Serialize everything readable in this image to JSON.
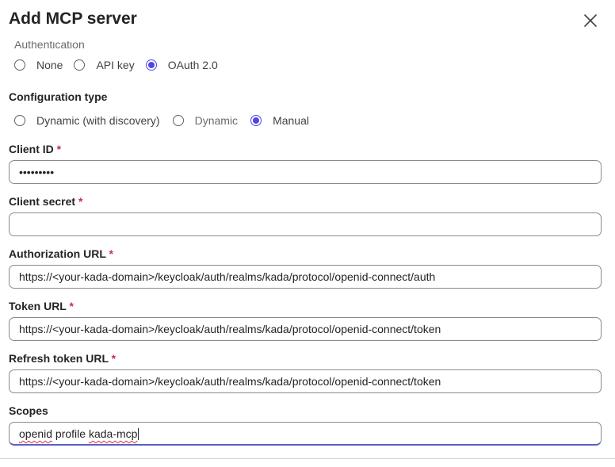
{
  "dialog": {
    "title": "Add MCP server"
  },
  "auth": {
    "section_label": "Authentication",
    "options": [
      {
        "label": "None",
        "checked": false
      },
      {
        "label": "API key",
        "checked": false
      },
      {
        "label": "OAuth 2.0",
        "checked": true
      }
    ]
  },
  "config_type": {
    "label": "Configuration type",
    "options": [
      {
        "label": "Dynamic (with discovery)",
        "checked": false
      },
      {
        "label": "Dynamic",
        "checked": false,
        "dim": true
      },
      {
        "label": "Manual",
        "checked": true
      }
    ]
  },
  "fields": {
    "client_id": {
      "label": "Client ID",
      "required_mark": "*",
      "value": "•••••••••"
    },
    "client_secret": {
      "label": "Client secret",
      "required_mark": "*",
      "value": ""
    },
    "authorization_url": {
      "label": "Authorization URL",
      "required_mark": "*",
      "value": "https://<your-kada-domain>/keycloak/auth/realms/kada/protocol/openid-connect/auth"
    },
    "token_url": {
      "label": "Token URL",
      "required_mark": "*",
      "value": "https://<your-kada-domain>/keycloak/auth/realms/kada/protocol/openid-connect/token"
    },
    "refresh_token_url": {
      "label": "Refresh token URL",
      "required_mark": "*",
      "value": "https://<your-kada-domain>/keycloak/auth/realms/kada/protocol/openid-connect/token"
    },
    "scopes": {
      "label": "Scopes",
      "value_parts": [
        "openid",
        " profile ",
        "kada-mcp"
      ]
    }
  },
  "colors": {
    "accent": "#4f46e5",
    "required": "#c4314b",
    "focus_underline": "#5b5fc7",
    "border": "#8a8a8a"
  },
  "icons": {
    "close": "close-icon"
  }
}
